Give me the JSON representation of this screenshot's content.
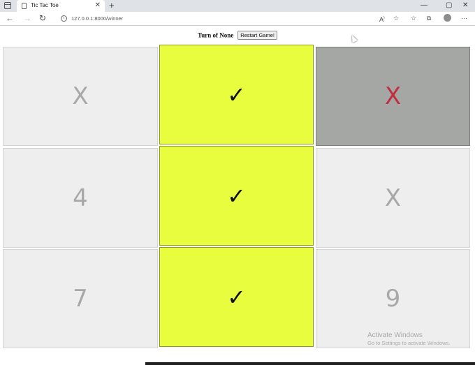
{
  "browser": {
    "tab_title": "Tic Tac Toe",
    "tab_close": "✕",
    "new_tab": "+",
    "url": "127.0.0.1:8000/winner",
    "window_controls": {
      "minimize": "—",
      "maximize": "▢",
      "close": "✕"
    },
    "toolbar_icons": [
      "read-aloud-icon",
      "add-favorite-icon",
      "favorites-icon",
      "collections-icon",
      "profile-icon",
      "more-icon"
    ]
  },
  "game": {
    "turn_label": "Turn of None",
    "restart_label": "Restart Game!",
    "cells": [
      "X",
      "✓",
      "X",
      "4",
      "✓",
      "X",
      "7",
      "✓",
      "9"
    ],
    "winning_cells": [
      1,
      4,
      7
    ],
    "last_move_cell": 2,
    "colors": {
      "winning": "#e8fd3e",
      "last_move_bg": "#a5a7a4",
      "last_move_text": "#c22e3d",
      "empty": "#eeeeee"
    }
  },
  "watermark": {
    "title": "Activate Windows",
    "subtitle": "Go to Settings to activate Windows."
  }
}
